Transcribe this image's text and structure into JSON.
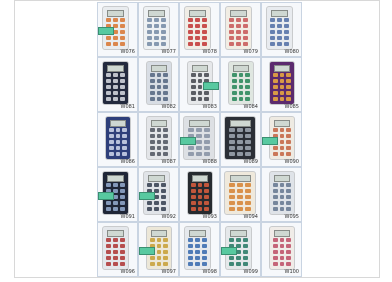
{
  "colors": {
    "page_background": "#ffffff",
    "frame_border": "#d8d8d8",
    "cell_background": "#f6f8fb",
    "ribbon_cable": "#58c9a0"
  },
  "catalog": {
    "items": [
      {
        "code": "W076",
        "face": "#e9ecef",
        "key": "#d97b3a",
        "style": 0,
        "tail": "left"
      },
      {
        "code": "W077",
        "face": "#eef1f3",
        "key": "#7a8fa8",
        "style": 0,
        "tail": "none"
      },
      {
        "code": "W078",
        "face": "#f0ede6",
        "key": "#c43d3d",
        "style": 0,
        "tail": "none"
      },
      {
        "code": "W079",
        "face": "#f1ede4",
        "key": "#c95d5d",
        "style": 0,
        "tail": "none"
      },
      {
        "code": "W080",
        "face": "#e8ebef",
        "key": "#5874a8",
        "style": 0,
        "tail": "none"
      },
      {
        "code": "W081",
        "face": "#232a3e",
        "key": "#cfd3da",
        "style": 0,
        "tail": "none"
      },
      {
        "code": "W082",
        "face": "#d8dde4",
        "key": "#5a6a84",
        "style": 1,
        "tail": "none"
      },
      {
        "code": "W083",
        "face": "#e6e8ea",
        "key": "#4b4f56",
        "style": 1,
        "tail": "right"
      },
      {
        "code": "W084",
        "face": "#dfe6e0",
        "key": "#2f8a5e",
        "style": 1,
        "tail": "none"
      },
      {
        "code": "W085",
        "face": "#5b2a6e",
        "key": "#e6a640",
        "style": 1,
        "tail": "none"
      },
      {
        "code": "W086",
        "face": "#2e3f7a",
        "key": "#c8cfe6",
        "style": 1,
        "tail": "none"
      },
      {
        "code": "W087",
        "face": "#e3e5e8",
        "key": "#555b66",
        "style": 1,
        "tail": "none"
      },
      {
        "code": "W088",
        "face": "#dde0e4",
        "key": "#8a95a5",
        "style": 2,
        "tail": "left"
      },
      {
        "code": "W089",
        "face": "#2b2f36",
        "key": "#9aa3ad",
        "style": 2,
        "tail": "none"
      },
      {
        "code": "W090",
        "face": "#eeeae2",
        "key": "#c56a4a",
        "style": 1,
        "tail": "left"
      },
      {
        "code": "W091",
        "face": "#1f2637",
        "key": "#8fa6c9",
        "style": 0,
        "tail": "left"
      },
      {
        "code": "W092",
        "face": "#e1e4e8",
        "key": "#3d4656",
        "style": 0,
        "tail": "left"
      },
      {
        "code": "W093",
        "face": "#262a2f",
        "key": "#d45b3d",
        "style": 1,
        "tail": "none"
      },
      {
        "code": "W094",
        "face": "#efe9dc",
        "key": "#d6873a",
        "style": 2,
        "tail": "none"
      },
      {
        "code": "W095",
        "face": "#dfe3e8",
        "key": "#6a7b94",
        "style": 1,
        "tail": "none"
      },
      {
        "code": "W096",
        "face": "#e4e7eb",
        "key": "#b03d3d",
        "style": 0,
        "tail": "none"
      },
      {
        "code": "W097",
        "face": "#ece7d8",
        "key": "#c9a23e",
        "style": 1,
        "tail": "left"
      },
      {
        "code": "W098",
        "face": "#e6e9ed",
        "key": "#3e6fb0",
        "style": 0,
        "tail": "none"
      },
      {
        "code": "W099",
        "face": "#e5e8ea",
        "key": "#2f7d6a",
        "style": 0,
        "tail": "left"
      },
      {
        "code": "W100",
        "face": "#f0ece8",
        "key": "#c0566d",
        "style": 1,
        "tail": "none"
      }
    ]
  }
}
